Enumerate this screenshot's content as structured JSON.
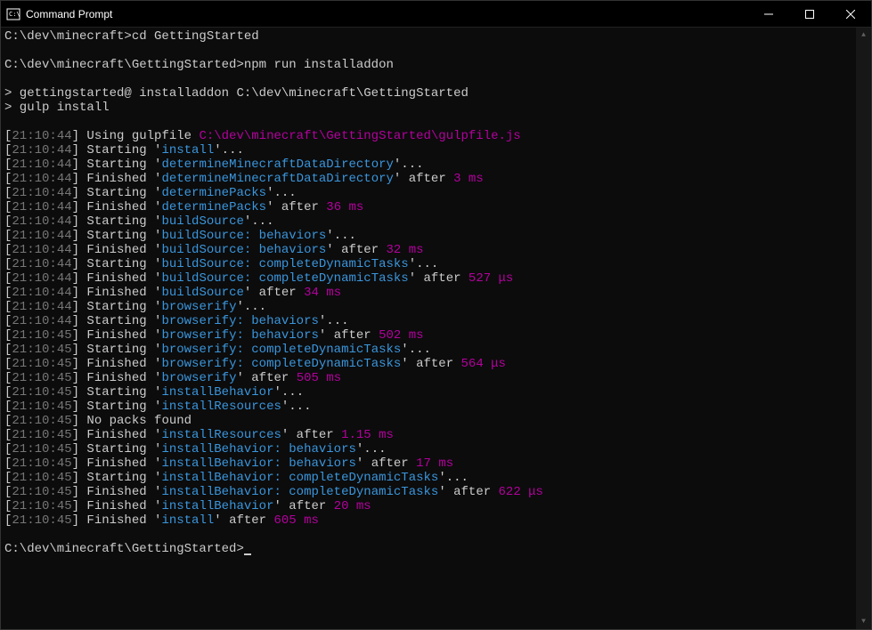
{
  "titlebar": {
    "title": "Command Prompt"
  },
  "commands": [
    {
      "prompt": "C:\\dev\\minecraft>",
      "cmd": "cd GettingStarted"
    },
    {
      "prompt": "C:\\dev\\minecraft\\GettingStarted>",
      "cmd": "npm run installaddon"
    }
  ],
  "npm_output": {
    "line1": "> gettingstarted@ installaddon C:\\dev\\minecraft\\GettingStarted",
    "line2": "> gulp install"
  },
  "gulp_lines": [
    {
      "ts": "21:10:44",
      "type": "using",
      "text": "Using gulpfile ",
      "cyan": "C:\\dev\\minecraft\\GettingStarted\\gulpfile.js"
    },
    {
      "ts": "21:10:44",
      "type": "starting",
      "task": "install"
    },
    {
      "ts": "21:10:44",
      "type": "starting",
      "task": "determineMinecraftDataDirectory"
    },
    {
      "ts": "21:10:44",
      "type": "finished",
      "task": "determineMinecraftDataDirectory",
      "duration": "3 ms"
    },
    {
      "ts": "21:10:44",
      "type": "starting",
      "task": "determinePacks"
    },
    {
      "ts": "21:10:44",
      "type": "finished",
      "task": "determinePacks",
      "duration": "36 ms"
    },
    {
      "ts": "21:10:44",
      "type": "starting",
      "task": "buildSource"
    },
    {
      "ts": "21:10:44",
      "type": "starting",
      "task": "buildSource: behaviors"
    },
    {
      "ts": "21:10:44",
      "type": "finished",
      "task": "buildSource: behaviors",
      "duration": "32 ms"
    },
    {
      "ts": "21:10:44",
      "type": "starting",
      "task": "buildSource: completeDynamicTasks"
    },
    {
      "ts": "21:10:44",
      "type": "finished",
      "task": "buildSource: completeDynamicTasks",
      "duration": "527 μs"
    },
    {
      "ts": "21:10:44",
      "type": "finished",
      "task": "buildSource",
      "duration": "34 ms"
    },
    {
      "ts": "21:10:44",
      "type": "starting",
      "task": "browserify"
    },
    {
      "ts": "21:10:44",
      "type": "starting",
      "task": "browserify: behaviors"
    },
    {
      "ts": "21:10:45",
      "type": "finished",
      "task": "browserify: behaviors",
      "duration": "502 ms"
    },
    {
      "ts": "21:10:45",
      "type": "starting",
      "task": "browserify: completeDynamicTasks"
    },
    {
      "ts": "21:10:45",
      "type": "finished",
      "task": "browserify: completeDynamicTasks",
      "duration": "564 μs"
    },
    {
      "ts": "21:10:45",
      "type": "finished",
      "task": "browserify",
      "duration": "505 ms"
    },
    {
      "ts": "21:10:45",
      "type": "starting",
      "task": "installBehavior"
    },
    {
      "ts": "21:10:45",
      "type": "starting",
      "task": "installResources"
    },
    {
      "ts": "21:10:45",
      "type": "plain",
      "text": "No packs found"
    },
    {
      "ts": "21:10:45",
      "type": "finished",
      "task": "installResources",
      "duration": "1.15 ms"
    },
    {
      "ts": "21:10:45",
      "type": "starting",
      "task": "installBehavior: behaviors"
    },
    {
      "ts": "21:10:45",
      "type": "finished",
      "task": "installBehavior: behaviors",
      "duration": "17 ms"
    },
    {
      "ts": "21:10:45",
      "type": "starting",
      "task": "installBehavior: completeDynamicTasks"
    },
    {
      "ts": "21:10:45",
      "type": "finished",
      "task": "installBehavior: completeDynamicTasks",
      "duration": "622 μs"
    },
    {
      "ts": "21:10:45",
      "type": "finished",
      "task": "installBehavior",
      "duration": "20 ms"
    },
    {
      "ts": "21:10:45",
      "type": "finished",
      "task": "install",
      "duration": "605 ms"
    }
  ],
  "final_prompt": "C:\\dev\\minecraft\\GettingStarted>"
}
